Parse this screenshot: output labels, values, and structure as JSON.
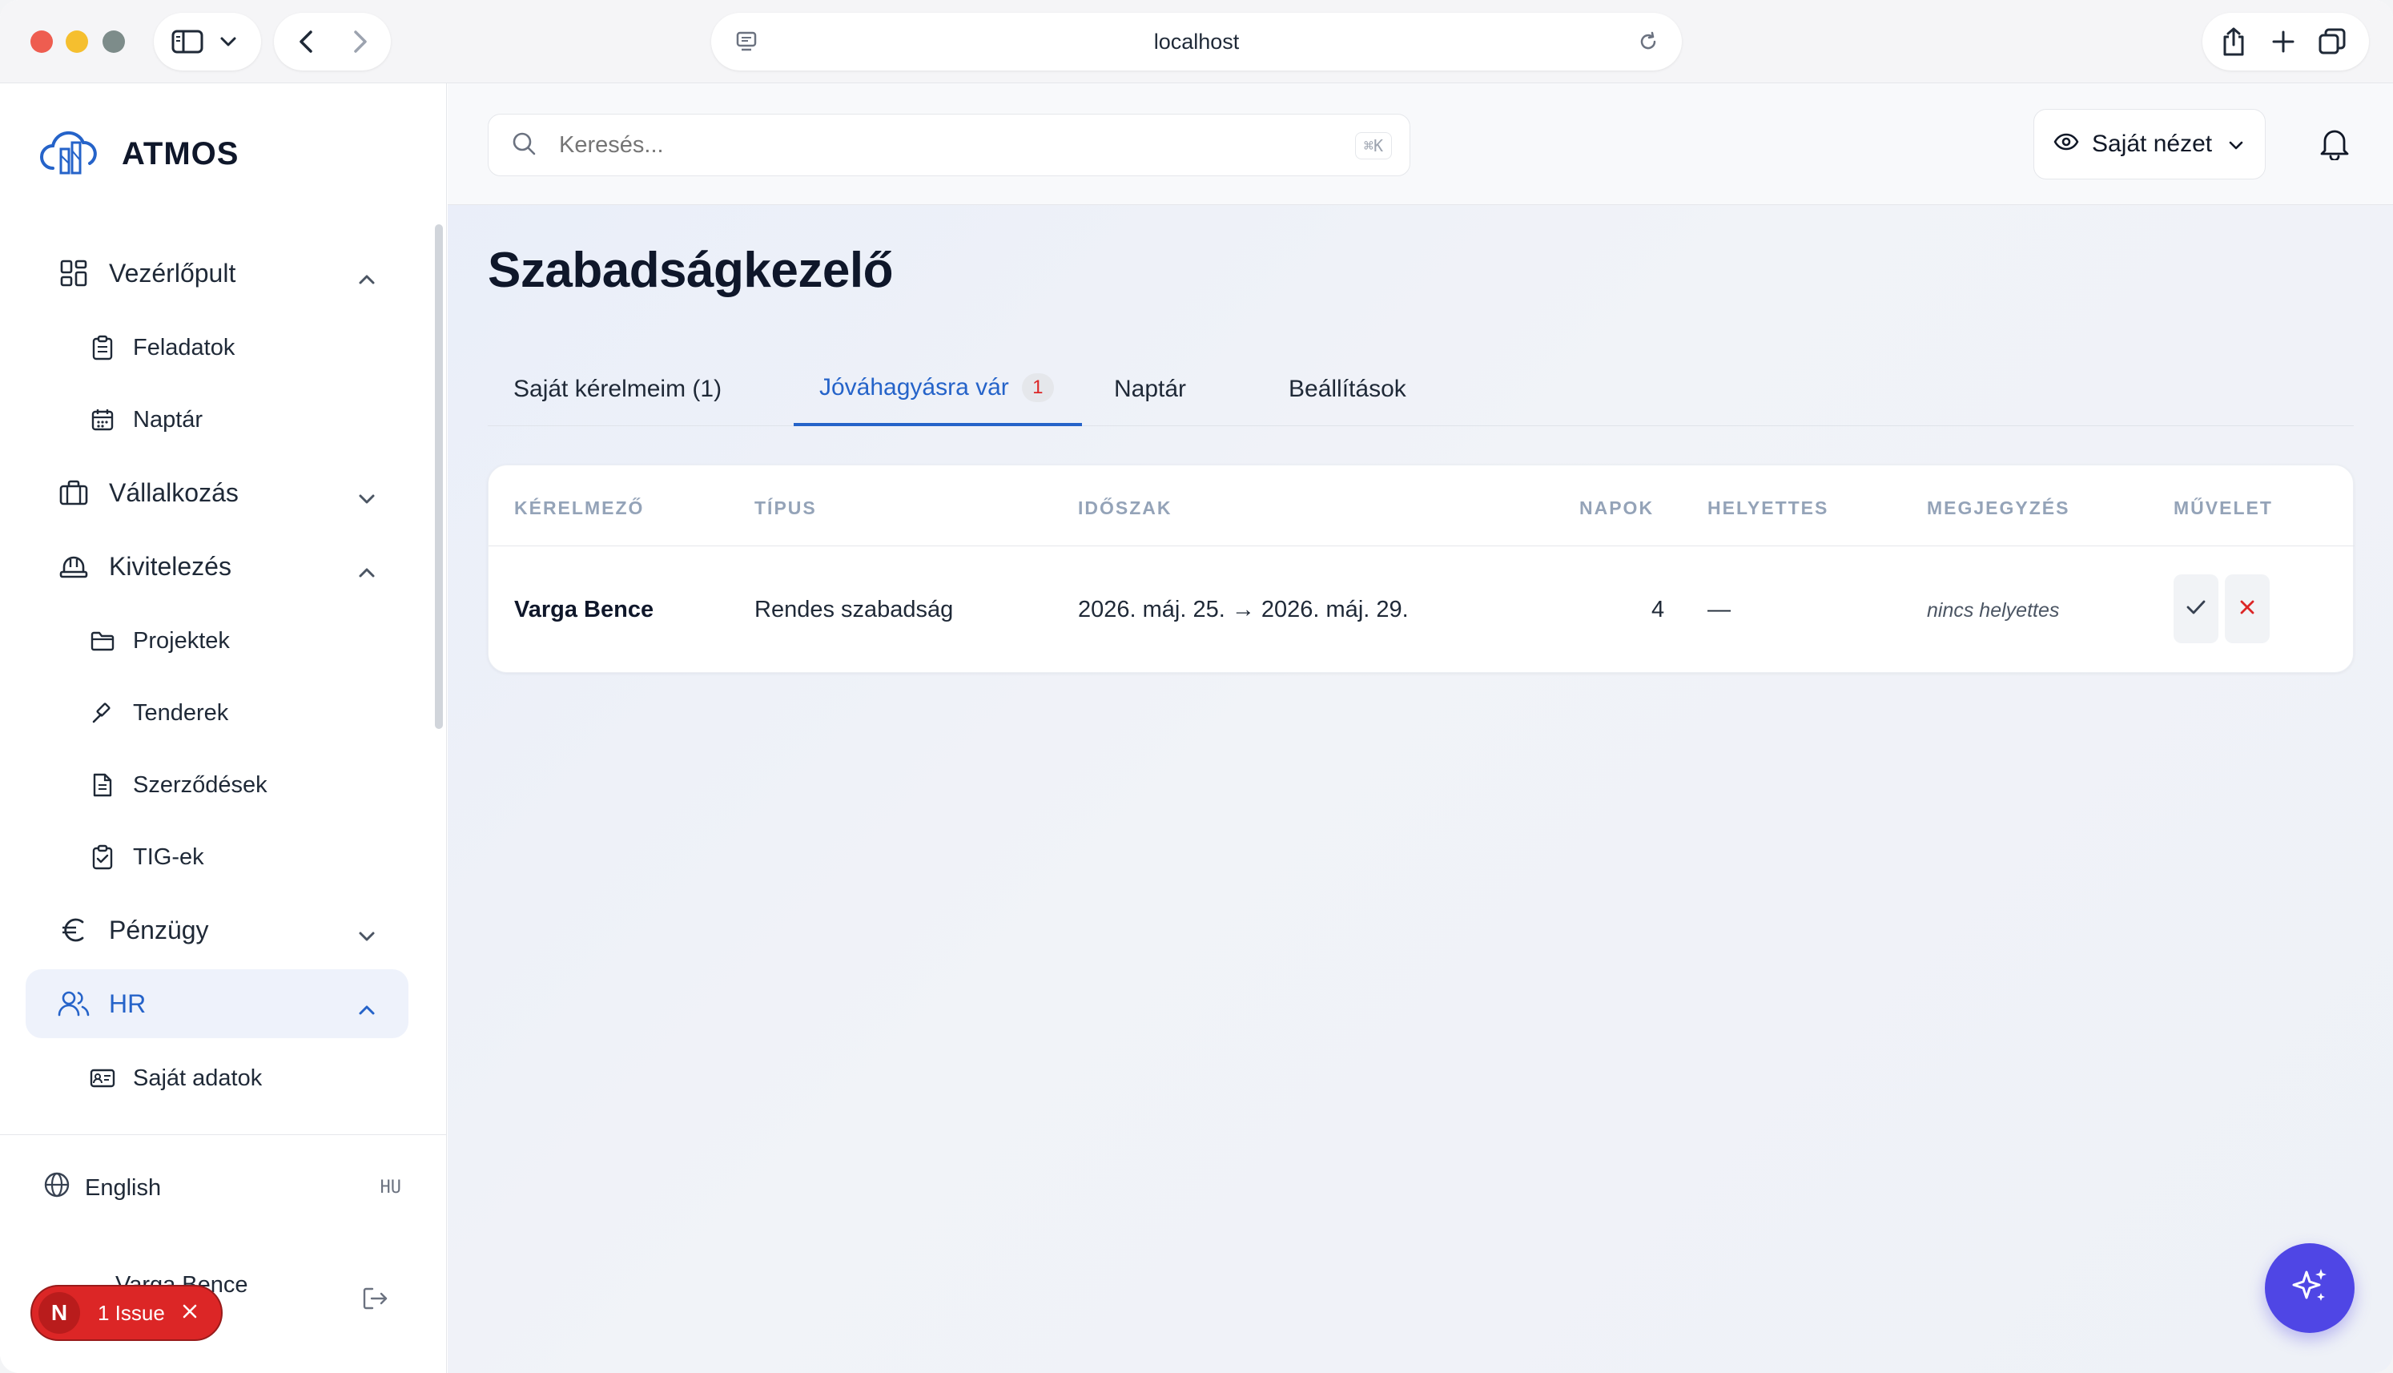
{
  "browser": {
    "url": "localhost"
  },
  "sidebar": {
    "brand": "ATMOS",
    "sections": [
      {
        "label": "Vezérlőpult",
        "icon": "dashboard-icon",
        "expanded": true
      },
      {
        "label": "Vállalkozás",
        "icon": "briefcase-icon",
        "expanded": false
      },
      {
        "label": "Kivitelezés",
        "icon": "hardhat-icon",
        "expanded": true
      },
      {
        "label": "Pénzügy",
        "icon": "euro-icon",
        "expanded": false
      },
      {
        "label": "HR",
        "icon": "users-icon",
        "expanded": true,
        "active": true
      }
    ],
    "sub_items": [
      {
        "label": "Feladatok",
        "icon": "clipboard-icon"
      },
      {
        "label": "Naptár",
        "icon": "calendar-icon"
      },
      {
        "label": "Projektek",
        "icon": "folder-icon"
      },
      {
        "label": "Tenderek",
        "icon": "gavel-icon"
      },
      {
        "label": "Szerződések",
        "icon": "document-icon"
      },
      {
        "label": "TIG-ek",
        "icon": "clipboard-check-icon"
      },
      {
        "label": "Saját adatok",
        "icon": "id-card-icon"
      }
    ],
    "language": {
      "label": "English",
      "code": "HU"
    },
    "user": {
      "name": "Varga Bence"
    },
    "issue_badge": {
      "letter": "N",
      "text": "1 Issue"
    }
  },
  "topbar": {
    "search_placeholder": "Keresés...",
    "shortcut": "⌘K",
    "view_label": "Saját nézet"
  },
  "page": {
    "title": "Szabadságkezelő",
    "tabs": [
      {
        "label": "Saját kérelmeim (1)",
        "active": false
      },
      {
        "label": "Jóváhagyásra vár",
        "badge": "1",
        "active": true
      },
      {
        "label": "Naptár",
        "active": false
      },
      {
        "label": "Beállítások",
        "active": false
      }
    ]
  },
  "table": {
    "columns": [
      "KÉRELMEZŐ",
      "TÍPUS",
      "IDŐSZAK",
      "NAPOK",
      "HELYETTES",
      "MEGJEGYZÉS",
      "MŰVELET"
    ],
    "rows": [
      {
        "applicant": "Varga Bence",
        "type": "Rendes szabadság",
        "period": "2026. máj. 25. → 2026. máj. 29.",
        "days": "4",
        "substitute": "—",
        "note": "nincs helyettes"
      }
    ]
  },
  "colors": {
    "accent": "#2563c9",
    "fab": "#4f46e5",
    "danger": "#dc2626"
  }
}
